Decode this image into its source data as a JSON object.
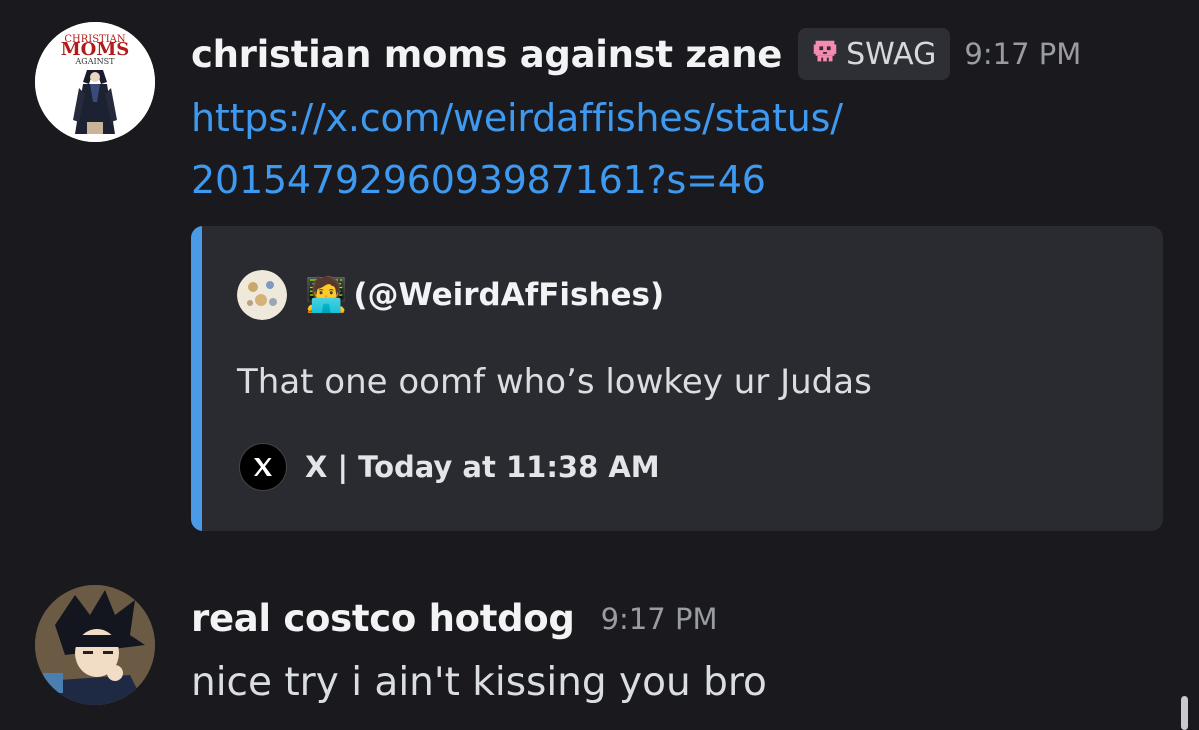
{
  "messages": [
    {
      "username": "christian moms against zane",
      "role_tag": {
        "icon": "skull-icon",
        "label": "SWAG",
        "icon_color": "#f58bb0"
      },
      "timestamp": "9:17 PM",
      "avatar_logo": {
        "line1": "CHRISTIAN",
        "line2": "MOMS",
        "line3": "AGAINST"
      },
      "link_lines": [
        "https://x.com/weirdaffishes/status/",
        "2015479296093987161?s=46"
      ],
      "embed": {
        "accent_color": "#4a9ae8",
        "author_emoji": "🧑‍💻",
        "author_handle": "(@WeirdAfFishes)",
        "description": "That one oomf who’s lowkey ur Judas",
        "footer_icon": "x-logo-icon",
        "footer_text": "X | Today at 11:38 AM"
      }
    },
    {
      "username": "real costco hotdog",
      "timestamp": "9:17 PM",
      "text": "nice try i ain't kissing you bro"
    }
  ],
  "colors": {
    "background": "#1a1a1e",
    "link": "#3e9af0",
    "embed_background": "#2a2b31"
  }
}
